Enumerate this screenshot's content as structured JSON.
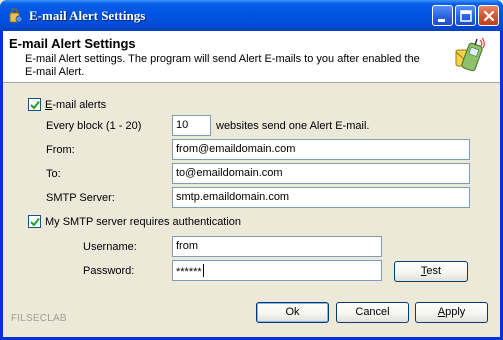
{
  "window": {
    "title": "E-mail Alert Settings",
    "accent_color": "#0054e3",
    "close_color": "#d25634"
  },
  "header": {
    "title": "E-mail Alert Settings",
    "subtitle": "E-mail Alert settings. The program will send Alert E-mails to you after enabled the E-mail Alert.",
    "icon": "phone-email-icon"
  },
  "form": {
    "email_alerts": {
      "label_prefix": "",
      "label_accel": "E",
      "label_rest": "-mail alerts",
      "checked": true
    },
    "every_block": {
      "label": "Every block (1 - 20)",
      "value": "10",
      "suffix": "websites send one Alert E-mail."
    },
    "from": {
      "label": "From:",
      "value": "from@emaildomain.com"
    },
    "to": {
      "label": "To:",
      "value": "to@emaildomain.com"
    },
    "smtp": {
      "label": "SMTP Server:",
      "value": "smtp.emaildomain.com"
    },
    "auth": {
      "label": "My SMTP server requires authentication",
      "checked": true
    },
    "username": {
      "label": "Username:",
      "value": "from"
    },
    "password": {
      "label": "Password:",
      "value": "******"
    },
    "test_button": {
      "accel": "T",
      "rest": "est"
    }
  },
  "footer": {
    "brand": "FILSECLAB",
    "ok_label": "Ok",
    "cancel_label": "Cancel",
    "apply_accel": "A",
    "apply_rest": "pply"
  }
}
